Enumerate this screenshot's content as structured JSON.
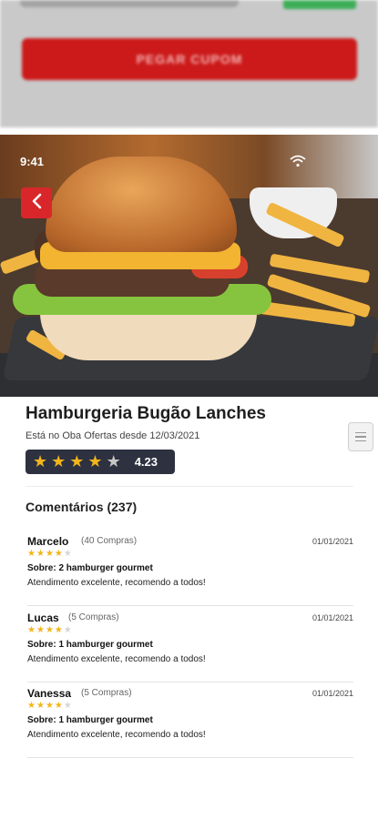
{
  "background_screen": {
    "coupon_button_label": "PEGAR CUPOM"
  },
  "status_bar": {
    "time": "9:41"
  },
  "restaurant": {
    "name": "Hamburgeria Bugão Lanches",
    "since": "Está no Oba Ofertas desde 12/03/2021",
    "rating": "4.23",
    "rating_stars": 4
  },
  "comments": {
    "title": "Comentários (237)",
    "items": [
      {
        "name": "Marcelo",
        "purchases": "(40 Compras)",
        "date": "01/01/2021",
        "stars": 4,
        "about": "Sobre: 2 hamburger gourmet",
        "text": "Atendimento excelente, recomendo a todos!"
      },
      {
        "name": "Lucas",
        "purchases": "(5 Compras)",
        "date": "01/01/2021",
        "stars": 4,
        "about": "Sobre: 1 hamburger gourmet",
        "text": "Atendimento excelente, recomendo a todos!"
      },
      {
        "name": "Vanessa",
        "purchases": "(5 Compras)",
        "date": "01/01/2021",
        "stars": 4,
        "about": "Sobre: 1 hamburger gourmet",
        "text": "Atendimento excelente, recomendo a todos!"
      }
    ]
  },
  "colors": {
    "accent": "#d9262b",
    "badge_bg": "#2d3140",
    "star": "#f2b51c"
  },
  "icons": {
    "back": "chevron-left-icon",
    "menu": "hamburger-menu-icon",
    "star": "star-icon",
    "wifi": "wifi-icon"
  }
}
